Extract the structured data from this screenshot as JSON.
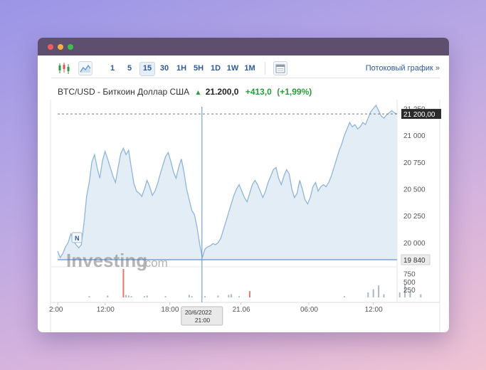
{
  "toolbar": {
    "periods": [
      "1",
      "5",
      "15",
      "30",
      "1H",
      "5H",
      "1D",
      "1W",
      "1M"
    ],
    "active_period": "15",
    "stream_link": "Потоковый график »"
  },
  "quote": {
    "name": "BTC/USD - Биткоин Доллар США",
    "price": "21.200,0",
    "change": "+413,0",
    "change_pct": "(+1,99%)"
  },
  "watermark": {
    "main": "Investing",
    "suffix": ".com"
  },
  "colors": {
    "accent": "#2d5a9c",
    "up": "#2a9b3c",
    "area_line": "#8fb5d8",
    "area_fill": "#e3edf6",
    "volume_up": "#a9b9c9",
    "volume_down": "#e07a6f"
  },
  "chart_data": {
    "type": "area",
    "y_tick_labels": [
      "21 250",
      "21 000",
      "20 750",
      "20 500",
      "20 250",
      "20 000"
    ],
    "y_ticks": [
      21250,
      21000,
      20750,
      20500,
      20250,
      20000
    ],
    "ylim": [
      19840,
      21300
    ],
    "x_tick_labels": [
      "2:00",
      "12:00",
      "18:00",
      "21.06",
      "06:00",
      "12:00"
    ],
    "x_tick_pos": [
      0.0,
      0.14,
      0.33,
      0.54,
      0.74,
      0.93
    ],
    "current_price_label": "21 200,00",
    "current_price": 21200,
    "crosshair_price_label": "19 840",
    "crosshair_price": 19840,
    "crosshair_time_label": [
      "20/6/2022",
      "21:00"
    ],
    "crosshair_x": 0.437,
    "marker_label": "N",
    "marker": {
      "x": 0.074,
      "y": 20040
    },
    "volume_tick_labels": [
      "750",
      "500",
      "250"
    ],
    "volume_ticks": [
      750,
      500,
      250
    ],
    "volume_max": 900,
    "series": [
      {
        "values": [
          19920,
          19860,
          19900,
          19960,
          20000,
          20080,
          20020,
          19980,
          19950,
          19980,
          20180,
          20430,
          20560,
          20750,
          20820,
          20700,
          20600,
          20760,
          20850,
          20780,
          20700,
          20620,
          20560,
          20700,
          20830,
          20880,
          20820,
          20860,
          20700,
          20550,
          20480,
          20460,
          20430,
          20500,
          20580,
          20520,
          20440,
          20480,
          20550,
          20640,
          20720,
          20800,
          20840,
          20760,
          20660,
          20600,
          20700,
          20780,
          20660,
          20500,
          20400,
          20300,
          20260,
          20140,
          19980,
          19860,
          19940,
          19960,
          19970,
          19990,
          19980,
          20000,
          20040,
          20120,
          20200,
          20280,
          20360,
          20440,
          20500,
          20540,
          20480,
          20420,
          20380,
          20460,
          20540,
          20580,
          20540,
          20480,
          20420,
          20480,
          20560,
          20620,
          20680,
          20700,
          20600,
          20540,
          20620,
          20680,
          20640,
          20500,
          20420,
          20460,
          20580,
          20500,
          20400,
          20360,
          20420,
          20520,
          20560,
          20480,
          20520,
          20540,
          20520,
          20560,
          20620,
          20700,
          20780,
          20860,
          20920,
          21000,
          21060,
          21120,
          21080,
          21100,
          21060,
          21080,
          21120,
          21100,
          21160,
          21220,
          21250,
          21280,
          21230,
          21180,
          21160,
          21190,
          21210,
          21230,
          21210,
          21200
        ]
      }
    ],
    "volume": [
      0,
      0,
      0,
      0,
      0,
      0,
      0,
      0,
      0,
      0,
      0,
      0,
      40,
      0,
      0,
      0,
      0,
      0,
      0,
      60,
      0,
      0,
      0,
      0,
      0,
      900,
      80,
      60,
      40,
      0,
      0,
      0,
      0,
      40,
      60,
      0,
      0,
      0,
      0,
      0,
      0,
      40,
      0,
      0,
      0,
      0,
      0,
      0,
      0,
      0,
      80,
      40,
      0,
      0,
      0,
      0,
      40,
      0,
      0,
      0,
      0,
      60,
      0,
      0,
      0,
      80,
      100,
      0,
      0,
      40,
      0,
      0,
      0,
      200,
      0,
      0,
      0,
      0,
      0,
      0,
      0,
      0,
      0,
      0,
      0,
      0,
      0,
      0,
      0,
      0,
      0,
      0,
      0,
      0,
      0,
      0,
      0,
      0,
      0,
      0,
      0,
      0,
      0,
      0,
      0,
      0,
      0,
      0,
      0,
      40,
      0,
      0,
      0,
      0,
      0,
      0,
      0,
      0,
      0,
      0,
      0,
      0,
      0,
      0,
      0,
      0,
      0,
      0,
      0,
      0
    ],
    "volume_red_idx": [
      25,
      73,
      104
    ],
    "volume_blue": [
      {
        "i": 118,
        "v": 160
      },
      {
        "i": 120,
        "v": 260
      },
      {
        "i": 122,
        "v": 380
      },
      {
        "i": 124,
        "v": 100
      },
      {
        "i": 130,
        "v": 160
      },
      {
        "i": 132,
        "v": 420
      },
      {
        "i": 134,
        "v": 190
      },
      {
        "i": 138,
        "v": 100
      }
    ]
  }
}
